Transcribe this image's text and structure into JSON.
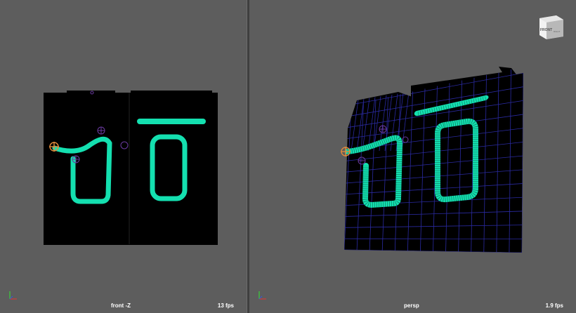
{
  "viewports": [
    {
      "label": "front -Z",
      "fps": "13 fps"
    },
    {
      "label": "persp",
      "fps": "1.9 fps"
    }
  ],
  "view_cube": {
    "face_label": "FRONT",
    "side_label": "RIGHT"
  },
  "colors": {
    "viewport_bg": "#5d5d5d",
    "plane": "#000000",
    "stroke": "#14e0b0",
    "wire": "#2a2aa0",
    "manipulator": "#e08a3a",
    "pivot": "#5b2a8a"
  },
  "icons": [
    "axis-gizmo-icon",
    "view-cube-icon",
    "manipulator-icon",
    "pivot-icon"
  ]
}
